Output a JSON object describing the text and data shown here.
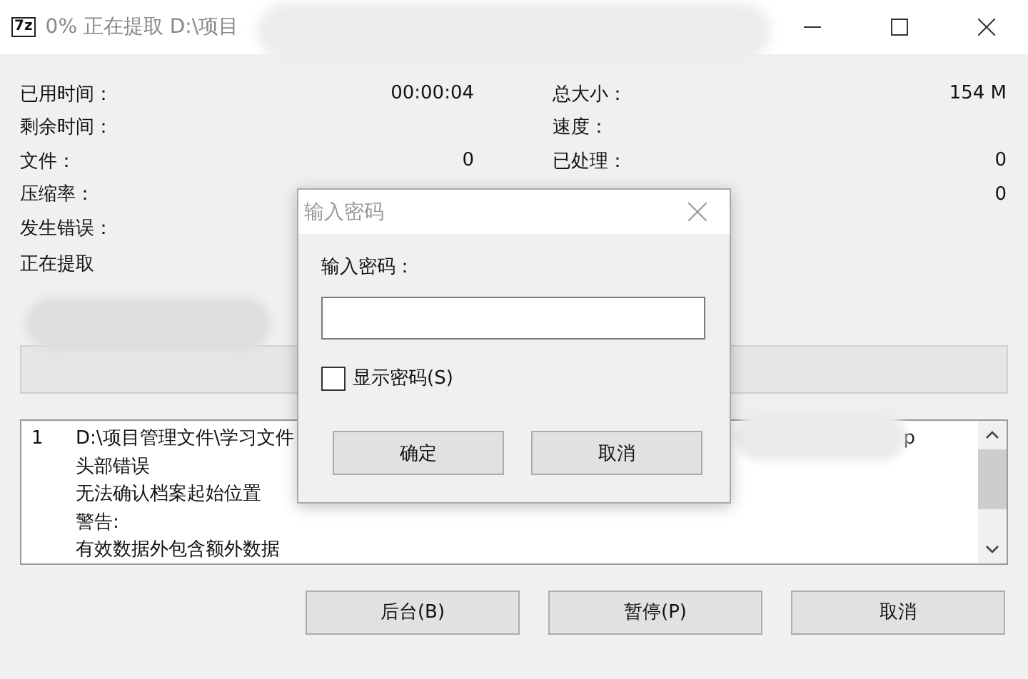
{
  "window": {
    "app_icon": "7z",
    "title": "0% 正在提取 D:\\项目"
  },
  "stats_left": [
    {
      "label": "已用时间：",
      "value": "00:00:04"
    },
    {
      "label": "剩余时间："
    },
    {
      "label": "文件：",
      "value": "0"
    },
    {
      "label": "压缩率："
    },
    {
      "label": "发生错误："
    }
  ],
  "stats_right": [
    {
      "label": "总大小：",
      "value": "154 M"
    },
    {
      "label": "速度："
    },
    {
      "label": "已处理：",
      "value": "0"
    },
    {
      "value": "0"
    }
  ],
  "status_text": "正在提取",
  "progress": {
    "level": 0
  },
  "log": [
    {
      "number": "1",
      "text": "D:\\项目管理文件\\学习文件",
      "tail": "p"
    },
    {
      "text": "头部错误"
    },
    {
      "text": "无法确认档案起始位置"
    },
    {
      "text": "警告:"
    },
    {
      "text": "有效数据外包含额外数据"
    }
  ],
  "buttons": [
    "后台(B)",
    "暂停(P)",
    "取消"
  ],
  "dialog": {
    "title": "输入密码",
    "label": "输入密码：",
    "show_password": {
      "label": "显示密码(S)",
      "checked": false
    },
    "buttons": [
      "确定",
      "取消"
    ]
  }
}
